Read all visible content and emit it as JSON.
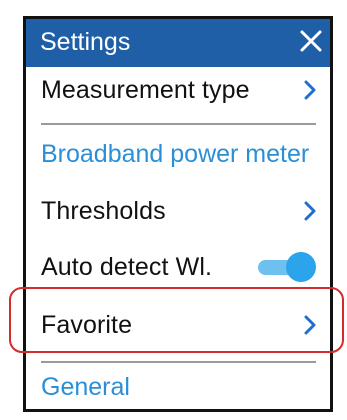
{
  "header": {
    "title": "Settings",
    "close_icon": "close-icon"
  },
  "colors": {
    "header_bg": "#1f5fa8",
    "accent": "#2b8fd8",
    "toggle_on": "#2ca4ec",
    "highlight": "#d42b2b"
  },
  "items": {
    "measurement_type": {
      "label": "Measurement type",
      "icon": "chevron-right-icon"
    },
    "thresholds": {
      "label": "Thresholds",
      "icon": "chevron-right-icon"
    },
    "auto_detect": {
      "label": "Auto detect Wl.",
      "toggle_state": "on"
    },
    "favorite": {
      "label": "Favorite",
      "icon": "chevron-right-icon"
    }
  },
  "sections": {
    "broadband": "Broadband power meter",
    "general": "General"
  }
}
